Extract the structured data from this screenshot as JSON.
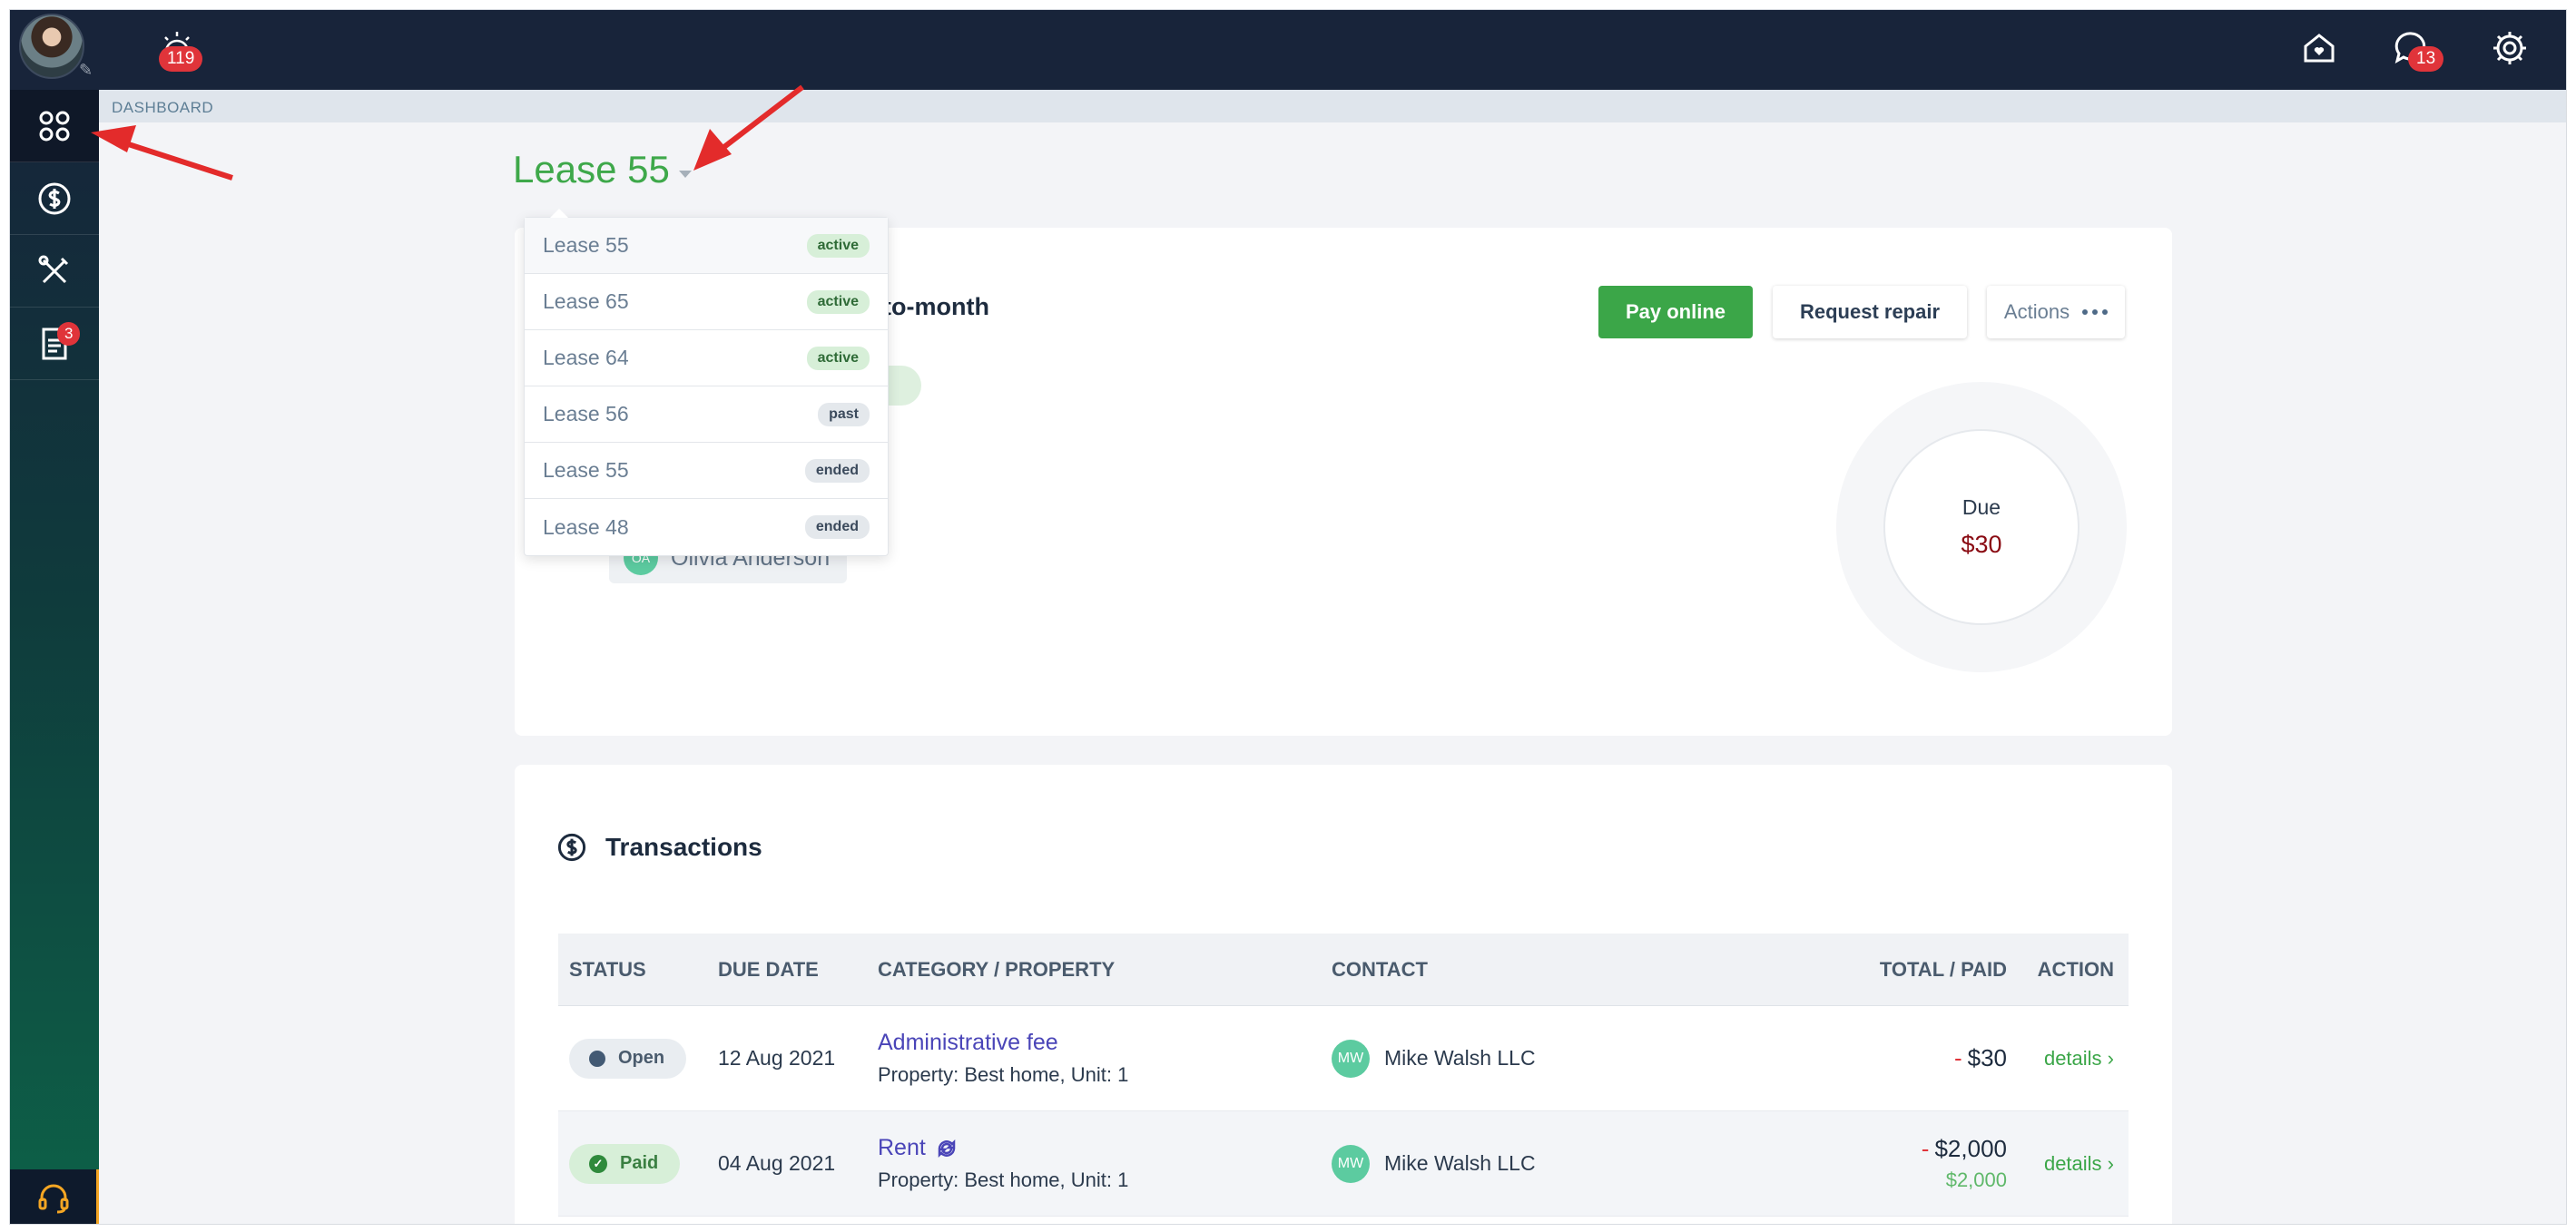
{
  "topbar": {
    "notifications_count": "119",
    "messages_count": "13",
    "icons": [
      "alarm-icon",
      "home-icon",
      "chat-icon",
      "gear-icon"
    ]
  },
  "sidebar": {
    "items": [
      {
        "icon": "dashboard-grid-icon",
        "active": true
      },
      {
        "icon": "dollar-circle-icon",
        "active": false
      },
      {
        "icon": "tools-icon",
        "active": false
      },
      {
        "icon": "document-icon",
        "badge": "3",
        "active": false
      }
    ],
    "support_icon": "headset-icon"
  },
  "breadcrumb": "DASHBOARD",
  "lease_selector": {
    "current": "Lease 55",
    "options": [
      {
        "label": "Lease 55",
        "status": "active"
      },
      {
        "label": "Lease 65",
        "status": "active"
      },
      {
        "label": "Lease 64",
        "status": "active"
      },
      {
        "label": "Lease 56",
        "status": "past"
      },
      {
        "label": "Lease 55",
        "status": "ended"
      },
      {
        "label": "Lease 48",
        "status": "ended"
      }
    ]
  },
  "lease_card": {
    "lease_type_visible": "to-month",
    "tenant": {
      "initials": "OA",
      "name": "Olivia Anderson"
    },
    "buttons": {
      "pay": "Pay online",
      "repair": "Request repair",
      "actions": "Actions"
    },
    "due": {
      "label": "Due",
      "amount": "$30"
    }
  },
  "transactions": {
    "title": "Transactions",
    "columns": [
      "STATUS",
      "DUE DATE",
      "CATEGORY / PROPERTY",
      "CONTACT",
      "TOTAL / PAID",
      "ACTION"
    ],
    "rows": [
      {
        "status": "Open",
        "due_date": "12 Aug 2021",
        "category": "Administrative fee",
        "property": "Property: Best home, Unit: 1",
        "contact_initials": "MW",
        "contact": "Mike Walsh LLC",
        "total": "$30",
        "paid": "",
        "action": "details"
      },
      {
        "status": "Paid",
        "due_date": "04 Aug 2021",
        "category": "Rent",
        "property": "Property: Best home, Unit: 1",
        "contact_initials": "MW",
        "contact": "Mike Walsh LLC",
        "total": "$2,000",
        "paid": "$2,000",
        "action": "details"
      }
    ]
  },
  "colors": {
    "brand_green": "#3ba648",
    "topbar": "#18243a",
    "badge_red": "#e0343a",
    "due_red": "#8a0b13",
    "link_purple": "#4a45b8"
  }
}
